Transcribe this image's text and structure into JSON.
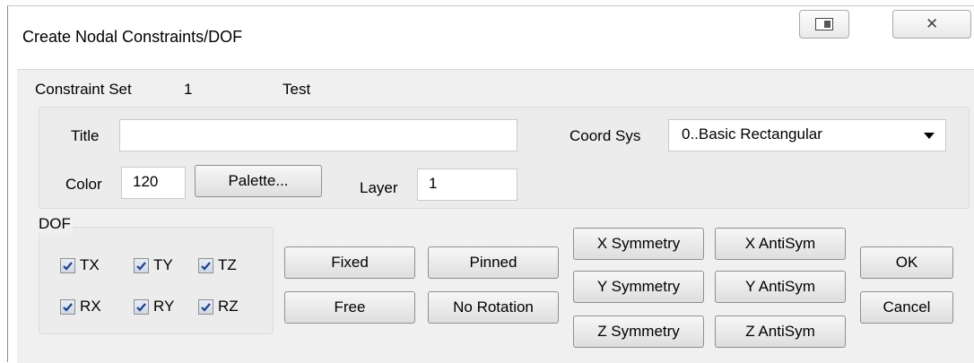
{
  "window": {
    "title": "Create Nodal Constraints/DOF",
    "close_glyph": "✕"
  },
  "constraint_set": {
    "label": "Constraint Set",
    "number": "1",
    "name": "Test"
  },
  "form": {
    "title_label": "Title",
    "title_value": "",
    "color_label": "Color",
    "color_value": "120",
    "palette_button": "Palette...",
    "layer_label": "Layer",
    "layer_value": "1",
    "coord_sys_label": "Coord Sys",
    "coord_sys_value": "0..Basic Rectangular"
  },
  "dof": {
    "group_label": "DOF",
    "checkboxes": [
      {
        "label": "TX",
        "checked": true
      },
      {
        "label": "TY",
        "checked": true
      },
      {
        "label": "TZ",
        "checked": true
      },
      {
        "label": "RX",
        "checked": true
      },
      {
        "label": "RY",
        "checked": true
      },
      {
        "label": "RZ",
        "checked": true
      }
    ]
  },
  "buttons": {
    "fixed": "Fixed",
    "pinned": "Pinned",
    "free": "Free",
    "no_rotation": "No Rotation",
    "x_symmetry": "X Symmetry",
    "x_antisym": "X AntiSym",
    "y_symmetry": "Y Symmetry",
    "y_antisym": "Y AntiSym",
    "z_symmetry": "Z Symmetry",
    "z_antisym": "Z AntiSym",
    "ok": "OK",
    "cancel": "Cancel"
  }
}
